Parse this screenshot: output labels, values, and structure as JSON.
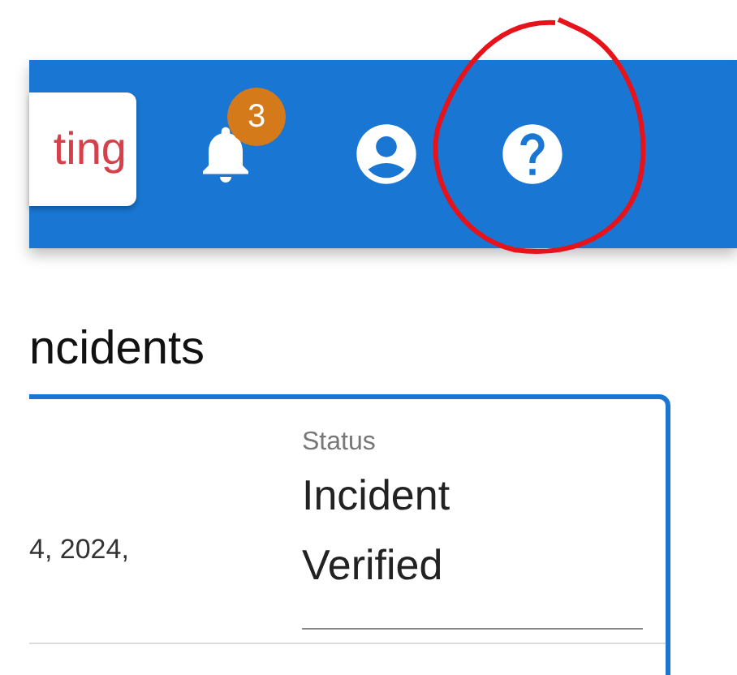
{
  "header": {
    "action_button": {
      "label": "ting"
    },
    "notifications": {
      "badge": "3"
    }
  },
  "annotations": [
    {
      "kind": "circle"
    }
  ],
  "page": {
    "title": "ncidents"
  },
  "incident_card": {
    "date": "4, 2024,",
    "status": {
      "label": "Status",
      "value": "Incident Verified"
    }
  }
}
